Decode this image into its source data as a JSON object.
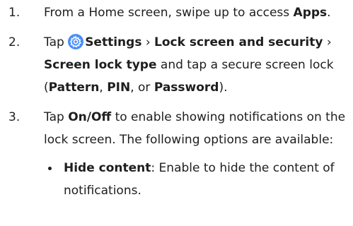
{
  "steps": [
    {
      "num": "1.",
      "text1": "From a Home screen, swipe up to access ",
      "bold1": "Apps",
      "text2": "."
    },
    {
      "num": "2.",
      "text1": "Tap ",
      "icon": "gear-icon",
      "bold1": "Settings",
      "text2": " › ",
      "bold2": "Lock screen and security",
      "text3": " › ",
      "bold3": "Screen lock type",
      "text4": " and tap a secure screen lock (",
      "bold4": "Pattern",
      "text5": ", ",
      "bold5": "PIN",
      "text6": ", or ",
      "bold6": "Password",
      "text7": ")."
    },
    {
      "num": "3.",
      "text1": "Tap ",
      "bold1": "On/Off",
      "text2": " to enable showing notifications on the lock screen. The following options are available:"
    }
  ],
  "bullets": [
    {
      "bold": "Hide content",
      "text": ": Enable to hide the content of notifications."
    }
  ],
  "colors": {
    "text": "#1e1e1e",
    "settings_icon": "#4a8df8"
  }
}
